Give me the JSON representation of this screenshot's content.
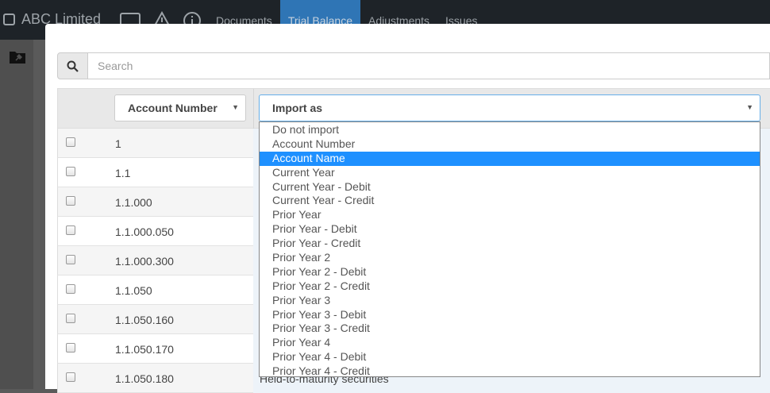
{
  "navbar": {
    "brand": "ABC Limited",
    "links": [
      "Documents",
      "Trial Balance",
      "Adjustments",
      "Issues"
    ],
    "active_link": "Trial Balance"
  },
  "search": {
    "placeholder": "Search"
  },
  "table": {
    "col1_select": "Account Number",
    "col2_select": "Import as",
    "rows": [
      {
        "account": "1",
        "name": ""
      },
      {
        "account": "1.1",
        "name": ""
      },
      {
        "account": "1.1.000",
        "name": ""
      },
      {
        "account": "1.1.000.050",
        "name": ""
      },
      {
        "account": "1.1.000.300",
        "name": ""
      },
      {
        "account": "1.1.050",
        "name": ""
      },
      {
        "account": "1.1.050.160",
        "name": ""
      },
      {
        "account": "1.1.050.170",
        "name": ""
      },
      {
        "account": "1.1.050.180",
        "name": "Held-to-maturity securities"
      }
    ]
  },
  "dropdown": {
    "options": [
      "Do not import",
      "Account Number",
      "Account Name",
      "Current Year",
      "Current Year - Debit",
      "Current Year - Credit",
      "Prior Year",
      "Prior Year - Debit",
      "Prior Year - Credit",
      "Prior Year 2",
      "Prior Year 2 - Debit",
      "Prior Year 2 - Credit",
      "Prior Year 3",
      "Prior Year 3 - Debit",
      "Prior Year 3 - Credit",
      "Prior Year 4",
      "Prior Year 4 - Debit",
      "Prior Year 4 - Credit"
    ],
    "selected": "Account Name"
  },
  "icons": {
    "brand": "checkbox-square-icon",
    "nav": [
      "window-icon",
      "warning-icon",
      "info-icon"
    ],
    "sidebar": "folder-pin-icon",
    "search": "search-icon"
  },
  "colors": {
    "navbar": "#1e2328",
    "active_tab": "#2f75b5",
    "highlight": "#1e90ff"
  }
}
